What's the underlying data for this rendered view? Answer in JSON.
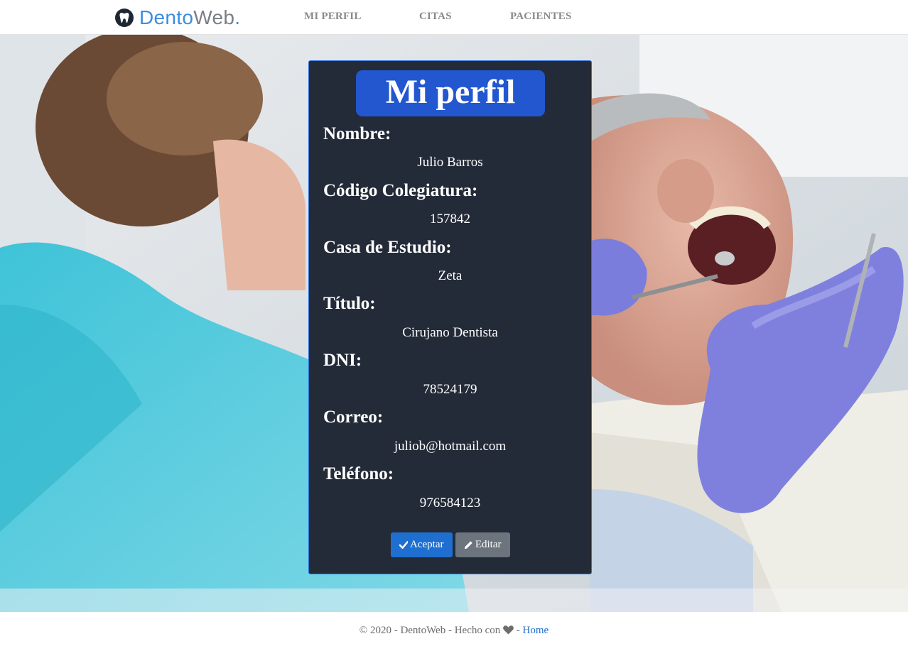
{
  "brand": {
    "part1": "Dento",
    "part2": "Web",
    "dot": ".",
    "icon": "tooth-icon"
  },
  "nav": {
    "items": [
      "MI PERFIL",
      "CITAS",
      "PACIENTES"
    ]
  },
  "profile": {
    "title": "Mi perfil",
    "fields": [
      {
        "label": "Nombre:",
        "value": "Julio Barros"
      },
      {
        "label": "Código Colegiatura:",
        "value": "157842"
      },
      {
        "label": "Casa de Estudio:",
        "value": "Zeta"
      },
      {
        "label": "Título:",
        "value": "Cirujano Dentista"
      },
      {
        "label": "DNI:",
        "value": "78524179"
      },
      {
        "label": "Correo:",
        "value": "juliob@hotmail.com"
      },
      {
        "label": "Teléfono:",
        "value": "976584123"
      }
    ],
    "accept_label": "Aceptar",
    "edit_label": "Editar"
  },
  "footer": {
    "text_before": "© 2020 - DentoWeb - Hecho con",
    "separator": "-",
    "home_link": "Home"
  },
  "colors": {
    "card_bg": "#232b38",
    "title_bg": "#2257d0",
    "primary": "#1f6fd1",
    "secondary": "#6c757d"
  }
}
